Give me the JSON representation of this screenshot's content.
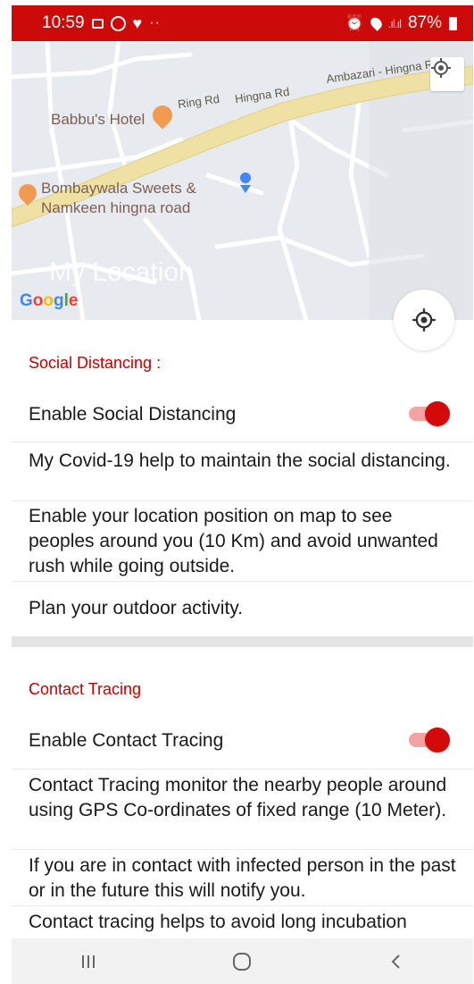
{
  "status_bar": {
    "time": "10:59",
    "dots": "··",
    "battery": "87%"
  },
  "map": {
    "places": [
      {
        "name": "Babbu's Hotel"
      },
      {
        "name": "Bombaywala Sweets &"
      },
      {
        "name": "Namkeen hingna road"
      }
    ],
    "roads": [
      "Ring Rd",
      "Hingna Rd",
      "Ambazari - Hingna Rd"
    ],
    "overlay_label": "My Location",
    "attribution": {
      "g1": "G",
      "o1": "o",
      "o2": "o",
      "g2": "g",
      "l": "l",
      "e": "e"
    }
  },
  "social_distancing": {
    "title": "Social Distancing :",
    "toggle_label": "Enable Social Distancing",
    "toggle_on": true,
    "desc1": "My Covid-19 help to maintain the social distancing.",
    "desc2": "Enable your location position on map to see peoples around you (10 Km) and avoid unwanted rush while going outside.",
    "desc3": "Plan your outdoor activity."
  },
  "contact_tracing": {
    "title": "Contact Tracing",
    "toggle_label": "Enable Contact Tracing",
    "toggle_on": true,
    "desc1": "Contact Tracing monitor the nearby people around using GPS Co-ordinates of fixed range (10 Meter).",
    "desc2": "If you are in contact with infected person in the past or in the future this will notify you.",
    "desc3": "Contact tracing helps to avoid long incubation"
  },
  "colors": {
    "accent": "#cc0a0a",
    "toggle_track": "#f3a3a3",
    "map_bg": "#e7eaef",
    "highway": "#efe0a3"
  }
}
